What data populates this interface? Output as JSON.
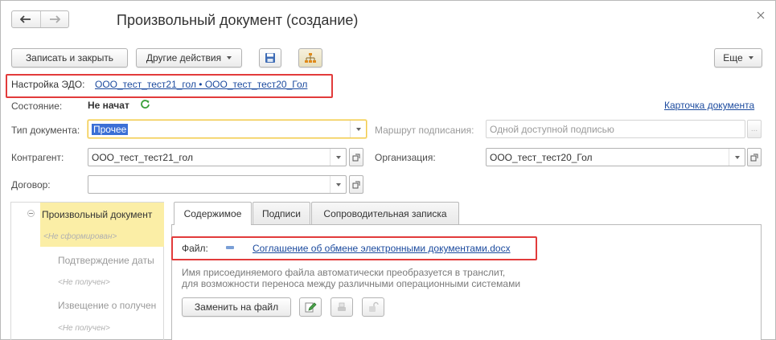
{
  "window": {
    "title": "Произвольный документ (создание)"
  },
  "toolbar": {
    "save_close_label": "Записать и закрыть",
    "other_actions_label": "Другие действия",
    "more_label": "Еще"
  },
  "edo": {
    "label": "Настройка ЭДО:",
    "value": "ООО_тест_тест21_гол • ООО_тест_тест20_Гол"
  },
  "state": {
    "label": "Состояние:",
    "value": "Не начат",
    "card_link": "Карточка документа"
  },
  "doc_type": {
    "label": "Тип документа:",
    "value": "Прочее"
  },
  "route": {
    "label": "Маршрут подписания:",
    "value": "Одной доступной подписью"
  },
  "counterparty": {
    "label": "Контрагент:",
    "value": "ООО_тест_тест21_гол"
  },
  "organization": {
    "label": "Организация:",
    "value": "ООО_тест_тест20_Гол"
  },
  "contract": {
    "label": "Договор:",
    "value": ""
  },
  "tree": {
    "items": [
      {
        "label": "Произвольный документ",
        "status": "<Не сформирован>"
      },
      {
        "label": "Подтверждение даты",
        "status": "<Не получен>"
      },
      {
        "label": "Извещение о получен",
        "status": "<Не получен>"
      }
    ]
  },
  "tabs": [
    {
      "label": "Содержимое"
    },
    {
      "label": "Подписи"
    },
    {
      "label": "Сопроводительная записка"
    }
  ],
  "file": {
    "label": "Файл:",
    "link": "Соглашение об обмене электронными документами.docx",
    "hint_line1": "Имя присоединяемого файла автоматически преобразуется в транслит,",
    "hint_line2": "для возможности переноса между различными операционными системами",
    "replace_label": "Заменить на файл"
  },
  "colors": {
    "link": "#1b4a9e",
    "highlight_box": "#e23b3b",
    "tree_selected": "#fbeea6",
    "refresh_icon": "#3aa03a"
  }
}
